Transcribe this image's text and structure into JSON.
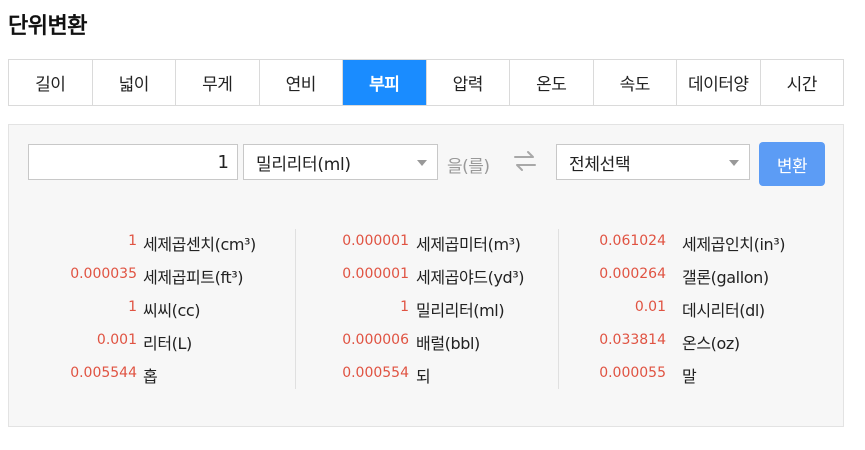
{
  "page_title": "단위변환",
  "tabs": [
    {
      "label": "길이"
    },
    {
      "label": "넓이"
    },
    {
      "label": "무게"
    },
    {
      "label": "연비"
    },
    {
      "label": "부피",
      "active": true
    },
    {
      "label": "압력"
    },
    {
      "label": "온도"
    },
    {
      "label": "속도"
    },
    {
      "label": "데이터양"
    },
    {
      "label": "시간"
    }
  ],
  "converter": {
    "input_value": "1",
    "from_unit": "밀리리터(ml)",
    "particle": "을(를)",
    "to_unit": "전체선택",
    "convert_label": "변환"
  },
  "results": {
    "col1": [
      {
        "value": "1",
        "unit": "세제곱센치(cm³)"
      },
      {
        "value": "0.000035",
        "unit": "세제곱피트(ft³)"
      },
      {
        "value": "1",
        "unit": "씨씨(cc)"
      },
      {
        "value": "0.001",
        "unit": "리터(L)"
      },
      {
        "value": "0.005544",
        "unit": "홉"
      }
    ],
    "col2": [
      {
        "value": "0.000001",
        "unit": "세제곱미터(m³)"
      },
      {
        "value": "0.000001",
        "unit": "세제곱야드(yd³)"
      },
      {
        "value": "1",
        "unit": "밀리리터(ml)"
      },
      {
        "value": "0.000006",
        "unit": "배럴(bbl)"
      },
      {
        "value": "0.000554",
        "unit": "되"
      }
    ],
    "col3": [
      {
        "value": "0.061024",
        "unit": "세제곱인치(in³)"
      },
      {
        "value": "0.000264",
        "unit": "갤론(gallon)"
      },
      {
        "value": "0.01",
        "unit": "데시리터(dl)"
      },
      {
        "value": "0.033814",
        "unit": "온스(oz)"
      },
      {
        "value": "0.000055",
        "unit": "말"
      }
    ]
  },
  "colors": {
    "accent": "#1a8cff",
    "button": "#5c9cf5",
    "value_text": "#e05342"
  },
  "icons": {
    "swap": "swap-arrows-icon",
    "dropdown": "chevron-down-icon"
  }
}
